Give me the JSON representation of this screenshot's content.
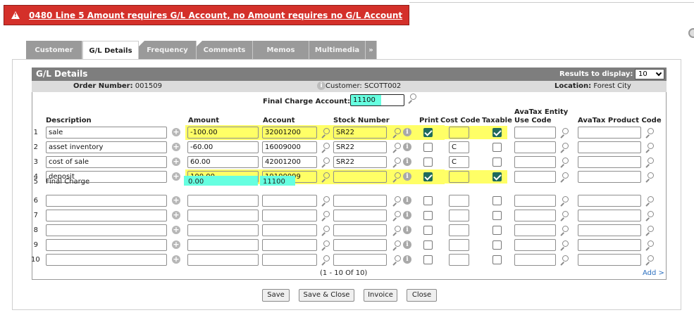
{
  "error": {
    "message": "0480 Line 5 Amount requires G/L Account, no Amount requires no G/L Account"
  },
  "tabs": [
    {
      "label": "Customer",
      "active": false
    },
    {
      "label": "G/L Details",
      "active": true
    },
    {
      "label": "Frequency",
      "active": false
    },
    {
      "label": "Comments",
      "active": false
    },
    {
      "label": "Memos",
      "active": false
    },
    {
      "label": "Multimedia",
      "active": false
    },
    {
      "label": "»",
      "active": false
    }
  ],
  "panel": {
    "title": "G/L Details",
    "results_label": "Results to display:",
    "results_value": "10",
    "order_label": "Order Number:",
    "order_value": "001509",
    "customer_label": "Customer:",
    "customer_value": "SCOTT002",
    "location_label": "Location:",
    "location_value": "Forest City",
    "final_charge_label": "Final Charge Account:",
    "final_charge_value": "11100"
  },
  "columns": {
    "description": "Description",
    "amount": "Amount",
    "account": "Account",
    "stock": "Stock Number",
    "print": "Print",
    "cost_code": "Cost Code",
    "taxable": "Taxable",
    "avatax_entity_1": "AvaTax Entity",
    "avatax_entity_2": "Use Code",
    "avatax_product": "AvaTax Product Code"
  },
  "rows": [
    {
      "num": "1",
      "description": "sale",
      "amount": "-100.00",
      "account": "32001200",
      "stock": "SR22",
      "print": true,
      "cost_code": "",
      "taxable": true,
      "highlight": true
    },
    {
      "num": "2",
      "description": "asset inventory",
      "amount": "-60.00",
      "account": "16009000",
      "stock": "SR22",
      "print": false,
      "cost_code": "C",
      "taxable": false,
      "highlight": false
    },
    {
      "num": "3",
      "description": "cost of sale",
      "amount": "60.00",
      "account": "42001200",
      "stock": "SR22",
      "print": false,
      "cost_code": "C",
      "taxable": false,
      "highlight": false
    },
    {
      "num": "4",
      "description": "deposit",
      "amount": "100.00",
      "account": "19100099",
      "stock": "",
      "print": true,
      "cost_code": "",
      "taxable": true,
      "highlight": true
    },
    {
      "num": "5",
      "description": "Final Charge",
      "amount": "0.00",
      "account": "11100",
      "final": true
    },
    {
      "num": "6",
      "description": "",
      "amount": "",
      "account": "",
      "stock": "",
      "print": false,
      "cost_code": "",
      "taxable": false
    },
    {
      "num": "7",
      "description": "",
      "amount": "",
      "account": "",
      "stock": "",
      "print": false,
      "cost_code": "",
      "taxable": false
    },
    {
      "num": "8",
      "description": "",
      "amount": "",
      "account": "",
      "stock": "",
      "print": false,
      "cost_code": "",
      "taxable": false
    },
    {
      "num": "9",
      "description": "",
      "amount": "",
      "account": "",
      "stock": "",
      "print": false,
      "cost_code": "",
      "taxable": false
    },
    {
      "num": "10",
      "description": "",
      "amount": "",
      "account": "",
      "stock": "",
      "print": false,
      "cost_code": "",
      "taxable": false
    }
  ],
  "pagination": "(1 - 10 Of 10)",
  "add_link": "Add >",
  "buttons": {
    "save": "Save",
    "save_close": "Save & Close",
    "invoice": "Invoice",
    "close": "Close"
  },
  "colors": {
    "error_bg": "#d4302a",
    "highlight_yellow": "#ffff66",
    "highlight_cyan": "#66ffe0",
    "checkbox_on": "#1f6b5c",
    "header_bar": "#7e7e7e"
  }
}
